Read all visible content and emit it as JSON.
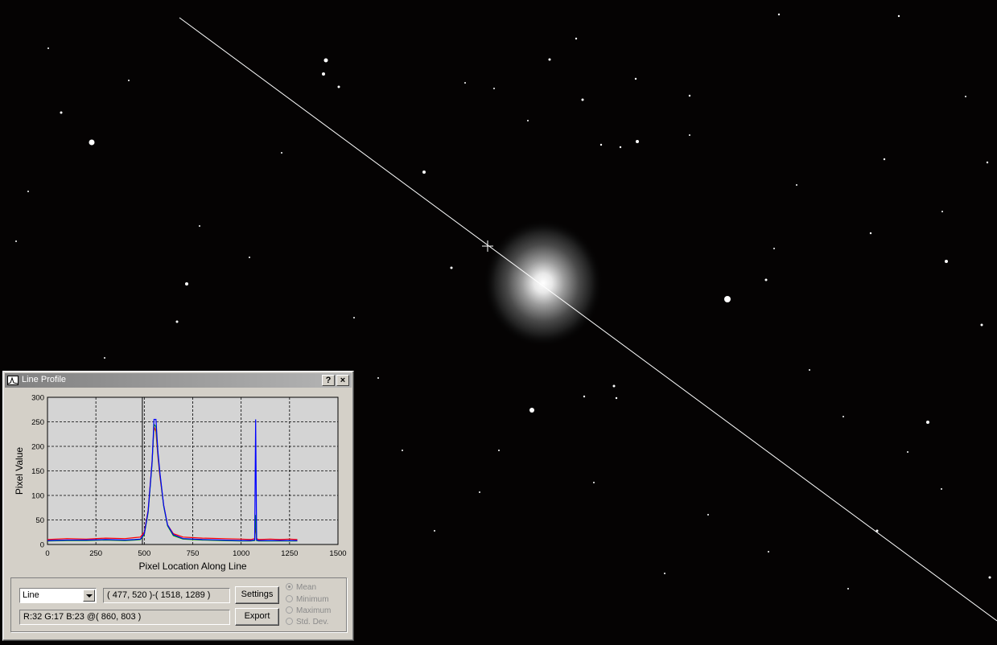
{
  "dialog": {
    "title": "Line Profile",
    "help_label": "?",
    "close_label": "×",
    "mode_select": "Line",
    "coords_text": "( 477, 520 )-( 1518, 1289 )",
    "pixel_info": "R:32 G:17 B:23 @( 860, 803 )",
    "settings_label": "Settings",
    "export_label": "Export",
    "stats": [
      {
        "label": "Mean",
        "checked": true
      },
      {
        "label": "Minimum",
        "checked": false
      },
      {
        "label": "Maximum",
        "checked": false
      },
      {
        "label": "Std. Dev.",
        "checked": false
      }
    ]
  },
  "chart_data": {
    "type": "line",
    "xlabel": "Pixel Location Along Line",
    "ylabel": "Pixel Value",
    "xlim": [
      0,
      1500
    ],
    "ylim": [
      0,
      300
    ],
    "xticks": [
      0,
      250,
      500,
      750,
      1000,
      1250,
      1500
    ],
    "yticks": [
      0,
      50,
      100,
      150,
      200,
      250,
      300
    ],
    "grid": true,
    "cursor_x": 490,
    "colors": {
      "red": "#ff0000",
      "green": "#00a000",
      "blue": "#0000ff"
    },
    "series": [
      {
        "color": "#ff0000",
        "x": [
          0,
          100,
          200,
          300,
          400,
          450,
          480,
          500,
          520,
          540,
          550,
          560,
          570,
          580,
          600,
          620,
          650,
          700,
          800,
          900,
          1000,
          1050,
          1070,
          1075,
          1080,
          1090,
          1150,
          1200,
          1250,
          1290
        ],
        "y": [
          10,
          12,
          11,
          13,
          12,
          14,
          15,
          25,
          70,
          170,
          240,
          230,
          180,
          140,
          80,
          40,
          22,
          15,
          13,
          12,
          11,
          10,
          12,
          40,
          12,
          10,
          11,
          10,
          11,
          10
        ]
      },
      {
        "color": "#00a000",
        "x": [
          0,
          100,
          200,
          300,
          400,
          450,
          480,
          500,
          520,
          540,
          550,
          560,
          570,
          580,
          600,
          620,
          650,
          700,
          800,
          900,
          1000,
          1050,
          1070,
          1075,
          1080,
          1090,
          1150,
          1200,
          1250,
          1290
        ],
        "y": [
          7,
          8,
          8,
          9,
          8,
          9,
          10,
          20,
          65,
          165,
          245,
          240,
          185,
          145,
          78,
          38,
          18,
          11,
          9,
          8,
          7,
          7,
          8,
          60,
          8,
          7,
          7,
          7,
          7,
          7
        ]
      },
      {
        "color": "#0000ff",
        "x": [
          0,
          100,
          200,
          300,
          400,
          450,
          480,
          500,
          520,
          540,
          550,
          560,
          570,
          580,
          600,
          620,
          650,
          700,
          800,
          900,
          1000,
          1050,
          1070,
          1075,
          1080,
          1090,
          1150,
          1200,
          1250,
          1290
        ],
        "y": [
          8,
          9,
          9,
          10,
          9,
          10,
          11,
          22,
          68,
          168,
          255,
          255,
          190,
          148,
          80,
          40,
          20,
          12,
          10,
          9,
          8,
          8,
          9,
          255,
          9,
          8,
          8,
          8,
          8,
          8
        ]
      }
    ]
  }
}
